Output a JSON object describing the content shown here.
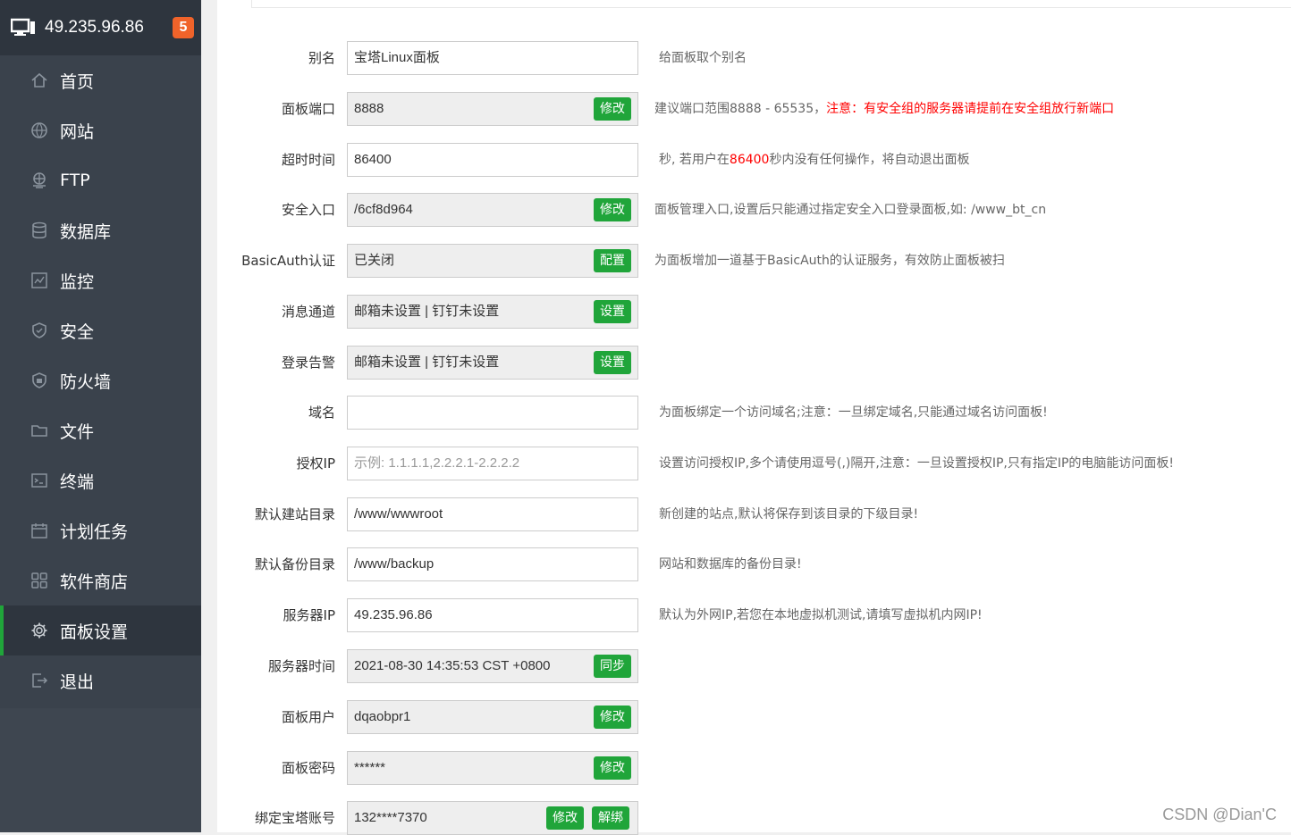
{
  "header": {
    "ip": "49.235.96.86",
    "badge": "5"
  },
  "menu": [
    {
      "label": "首页",
      "icon": "home-icon"
    },
    {
      "label": "网站",
      "icon": "globe-icon"
    },
    {
      "label": "FTP",
      "icon": "ftp-icon"
    },
    {
      "label": "数据库",
      "icon": "database-icon"
    },
    {
      "label": "监控",
      "icon": "monitor-icon"
    },
    {
      "label": "安全",
      "icon": "shield-icon"
    },
    {
      "label": "防火墙",
      "icon": "firewall-icon"
    },
    {
      "label": "文件",
      "icon": "folder-icon"
    },
    {
      "label": "终端",
      "icon": "terminal-icon"
    },
    {
      "label": "计划任务",
      "icon": "calendar-icon"
    },
    {
      "label": "软件商店",
      "icon": "apps-icon"
    },
    {
      "label": "面板设置",
      "icon": "gear-icon",
      "active": true
    },
    {
      "label": "退出",
      "icon": "logout-icon"
    }
  ],
  "settings": {
    "alias": {
      "label": "别名",
      "value": "宝塔Linux面板",
      "help": "给面板取个别名"
    },
    "port": {
      "label": "面板端口",
      "value": "8888",
      "btn": "修改",
      "help": "建议端口范围8888 - 65535，",
      "help_red": "注意：有安全组的服务器请提前在安全组放行新端口"
    },
    "timeout": {
      "label": "超时时间",
      "value": "86400",
      "help_a": "秒, 若用户在",
      "help_red": "86400",
      "help_b": "秒内没有任何操作，将自动退出面板"
    },
    "entry": {
      "label": "安全入口",
      "value": "/6cf8d964",
      "btn": "修改",
      "help": "面板管理入口,设置后只能通过指定安全入口登录面板,如: /www_bt_cn"
    },
    "basicauth": {
      "label": "BasicAuth认证",
      "value": "已关闭",
      "btn": "配置",
      "help": "为面板增加一道基于BasicAuth的认证服务，有效防止面板被扫"
    },
    "channel": {
      "label": "消息通道",
      "value": "邮箱未设置 | 钉钉未设置",
      "btn": "设置"
    },
    "login_alert": {
      "label": "登录告警",
      "value": "邮箱未设置 | 钉钉未设置",
      "btn": "设置"
    },
    "domain": {
      "label": "域名",
      "value": "",
      "help": "为面板绑定一个访问域名;注意：一旦绑定域名,只能通过域名访问面板!"
    },
    "auth_ip": {
      "label": "授权IP",
      "placeholder": "示例: 1.1.1.1,2.2.2.1-2.2.2.2",
      "help": "设置访问授权IP,多个请使用逗号(,)隔开,注意：一旦设置授权IP,只有指定IP的电脑能访问面板!"
    },
    "site_dir": {
      "label": "默认建站目录",
      "value": "/www/wwwroot",
      "help": "新创建的站点,默认将保存到该目录的下级目录!"
    },
    "backup_dir": {
      "label": "默认备份目录",
      "value": "/www/backup",
      "help": "网站和数据库的备份目录!"
    },
    "server_ip": {
      "label": "服务器IP",
      "value": "49.235.96.86",
      "help": "默认为外网IP,若您在本地虚拟机测试,请填写虚拟机内网IP!"
    },
    "server_time": {
      "label": "服务器时间",
      "value": "2021-08-30 14:35:53 CST +0800",
      "btn": "同步"
    },
    "panel_user": {
      "label": "面板用户",
      "value": "dqaobpr1",
      "btn": "修改"
    },
    "panel_pass": {
      "label": "面板密码",
      "value": "******",
      "btn": "修改"
    },
    "bt_account": {
      "label": "绑定宝塔账号",
      "value": "132****7370",
      "btn": "修改",
      "btn2": "解绑"
    }
  },
  "watermark": "CSDN @Dian'C",
  "colors": {
    "accent": "#20a53a",
    "badge": "#f0632a",
    "sidebar": "#3a424c"
  }
}
